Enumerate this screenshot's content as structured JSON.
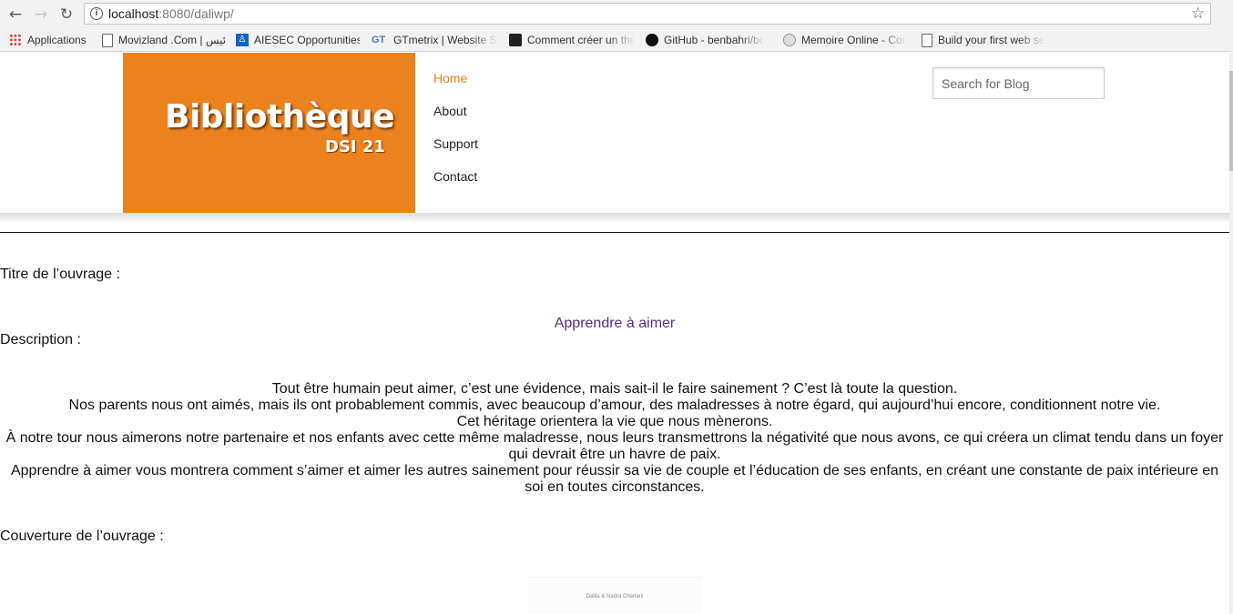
{
  "browser": {
    "url_host": "localhost",
    "url_path": ":8080/daliwp/",
    "bookmarks": [
      {
        "label": "Applications",
        "icon": "apps-grid-icon"
      },
      {
        "label": "Movizland .Com | رئيس",
        "icon": "document-icon"
      },
      {
        "label": "AIESEC Opportunities",
        "icon": "aiesec-icon"
      },
      {
        "label": "GTmetrix | Website Sp",
        "icon": "gtmetrix-icon"
      },
      {
        "label": "Comment créer un thè",
        "icon": "dark-square-icon"
      },
      {
        "label": "GitHub - benbahri/bo",
        "icon": "github-icon"
      },
      {
        "label": "Memoire Online - Cor",
        "icon": "globe-icon"
      },
      {
        "label": "Build your first web se",
        "icon": "document-icon"
      }
    ]
  },
  "site": {
    "logo_title": "Bibliothèque",
    "logo_subtitle": "DSI 21",
    "menu": [
      "Home",
      "About",
      "Support",
      "Contact"
    ],
    "active_menu": "Home",
    "search_placeholder": "Search for Blog",
    "accent_color": "#ec821e"
  },
  "content": {
    "title_label": "Titre de l’ouvrage :",
    "book_title": "Apprendre à aimer",
    "description_label": "Description :",
    "description_lines": [
      "Tout être humain peut aimer, c’est une évidence, mais sait-il le faire sainement ? C’est là toute la question.",
      "Nos parents nous ont aimés, mais ils ont probablement commis, avec beaucoup d’amour, des maladresses à notre égard, qui aujourd’hui encore, conditionnent notre vie.",
      "Cet héritage orientera la vie que nous mènerons.",
      "À notre tour nous aimerons notre partenaire et nos enfants avec cette même maladresse, nous leurs transmettrons la négativité que nous avons, ce qui créera un climat tendu dans un foyer qui devrait être un havre de paix.",
      "Apprendre à aimer vous montrera comment s’aimer et aimer les autres sainement pour réussir sa vie de couple et l’éducation de ses enfants, en créant une constante de paix intérieure en soi en toutes circonstances."
    ],
    "cover_label": "Couverture de l’ouvrage :",
    "cover_author": "Dalila & Nadra Cherlani"
  }
}
